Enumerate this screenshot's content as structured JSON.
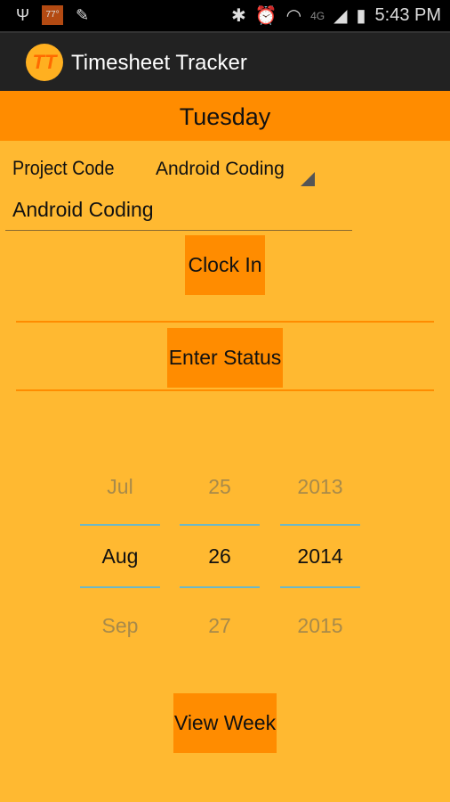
{
  "status_bar": {
    "temperature": "77°",
    "time": "5:43 PM",
    "network": "4G"
  },
  "app": {
    "title": "Timesheet Tracker",
    "logo_text": "TT"
  },
  "day": "Tuesday",
  "project": {
    "label": "Project Code",
    "selected": "Android Coding",
    "input_value": "Android Coding"
  },
  "buttons": {
    "clock_in": "Clock In",
    "enter_status": "Enter Status",
    "view_week": "View Week"
  },
  "date_picker": {
    "month": {
      "prev": "Jul",
      "current": "Aug",
      "next": "Sep"
    },
    "day": {
      "prev": "25",
      "current": "26",
      "next": "27"
    },
    "year": {
      "prev": "2013",
      "current": "2014",
      "next": "2015"
    }
  },
  "colors": {
    "background": "#ffb931",
    "accent": "#ff8c00",
    "divider": "#6cb8c8"
  }
}
